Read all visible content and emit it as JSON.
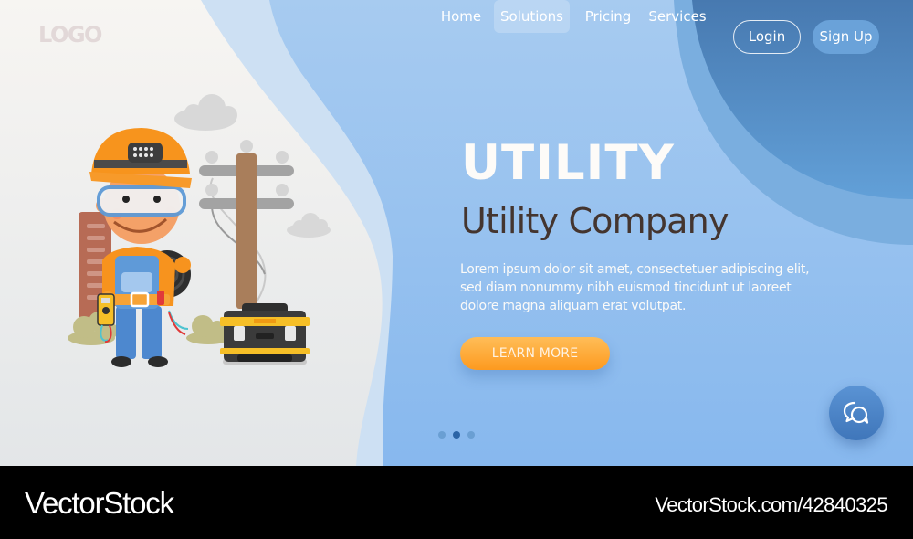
{
  "header": {
    "logo": "LOGO",
    "nav": [
      {
        "label": "Home",
        "active": false
      },
      {
        "label": "Solutions",
        "active": true
      },
      {
        "label": "Pricing",
        "active": false
      },
      {
        "label": "Services",
        "active": false
      }
    ],
    "login_label": "Login",
    "signup_label": "Sign Up"
  },
  "hero": {
    "title": "UTILITY",
    "subtitle": "Utility Company",
    "body": "Lorem ipsum dolor sit amet, consectetuer adipiscing elit, sed diam nonummy nibh euismod tincidunt ut laoreet dolore magna aliquam erat volutpat.",
    "cta_label": "LEARN MORE"
  },
  "carousel": {
    "slide_count": 3,
    "active_index": 1
  },
  "chat": {
    "icon": "chat-bubbles-icon"
  },
  "illustration": {
    "subject": "utility worker with cable, utility pole, toolbox",
    "icons": [
      "worker-icon",
      "utility-pole-icon",
      "toolbox-icon",
      "cloud-icon",
      "building-icon",
      "bush-icon"
    ]
  },
  "colors": {
    "accent_orange": "#fd9a1f",
    "primary_blue": "#8dbdee",
    "dark_blue": "#4a7fb8",
    "title_dark": "#44352f"
  },
  "watermark": {
    "brand": "VectorStock",
    "id_text": "VectorStock.com/42840325"
  }
}
